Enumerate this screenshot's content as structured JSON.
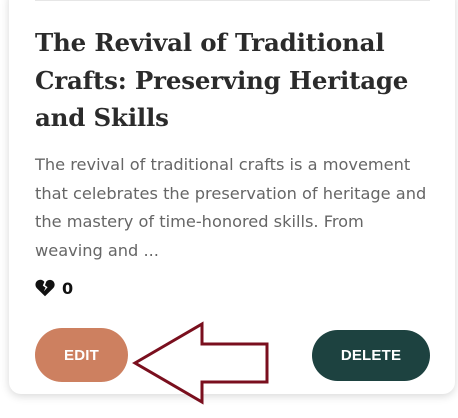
{
  "post": {
    "title": "The Revival of Traditional Crafts: Preserving Heritage and Skills",
    "excerpt": "The revival of traditional crafts is a movement that celebrates the preservation of heritage and the mastery of time-honored skills. From weaving and ...",
    "likes_count": "0",
    "like_icon": "broken-heart-icon"
  },
  "actions": {
    "edit_label": "EDIT",
    "delete_label": "DELETE"
  },
  "annotation": {
    "arrow_icon": "left-arrow-outline-icon",
    "arrow_color": "#7a0f1e"
  },
  "colors": {
    "edit_button": "#cd8060",
    "delete_button": "#1d4240",
    "title_text": "#2b2b2b",
    "excerpt_text": "#666666"
  }
}
